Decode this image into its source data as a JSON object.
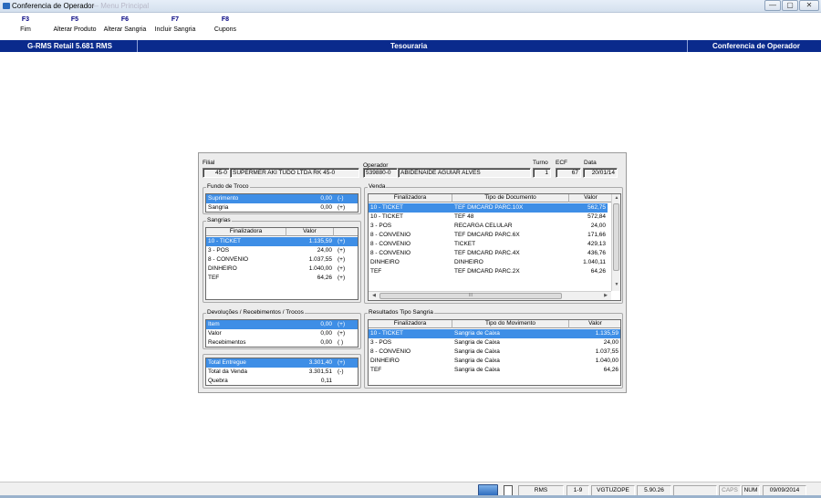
{
  "window": {
    "title": "Conferencia de Operador",
    "bg_title": "— Menu Principal"
  },
  "controls": {
    "minimize": "—",
    "maximize": "▢",
    "close": "✕"
  },
  "toolbar": [
    {
      "key": "F3",
      "label": "Fim"
    },
    {
      "key": "F5",
      "label": "Alterar Produto"
    },
    {
      "key": "F6",
      "label": "Alterar Sangria"
    },
    {
      "key": "F7",
      "label": "Incluir Sangria"
    },
    {
      "key": "F8",
      "label": "Cupons"
    }
  ],
  "bluebar": {
    "left": "G-RMS Retail 5.681 RMS",
    "center": "Tesouraria",
    "right": "Conferencia de Operador"
  },
  "header": {
    "filial_label": "Filial",
    "filial_code": "45-0",
    "filial_name": "SUPERMER AKI TUDO LTDA RK 45-0",
    "operador_label": "Operador",
    "operador_code": "539880-0",
    "operador_name": "ABIDENAIDE AGUIAR ALVES",
    "turno_label": "Turno",
    "turno": "1",
    "ecf_label": "ECF",
    "ecf": "67",
    "data_label": "Data",
    "data": "20/01/14"
  },
  "fundo": {
    "title": "Fundo de Troco",
    "rows": [
      {
        "name": "Suprimento",
        "value": "0,00",
        "flag": "(-)"
      },
      {
        "name": "Sangria",
        "value": "0,00",
        "flag": "(+)"
      }
    ]
  },
  "sangrias": {
    "title": "Sangrias",
    "headers": [
      "Finalizadora",
      "Valor"
    ],
    "rows": [
      {
        "name": "10 - TICKET",
        "value": "1.135,59",
        "flag": "(+)"
      },
      {
        "name": "3 - POS",
        "value": "24,00",
        "flag": "(+)"
      },
      {
        "name": "8 - CONVENIO",
        "value": "1.037,55",
        "flag": "(+)"
      },
      {
        "name": "DINHEIRO",
        "value": "1.040,00",
        "flag": "(+)"
      },
      {
        "name": "TEF",
        "value": "64,26",
        "flag": "(+)"
      }
    ]
  },
  "devolucoes": {
    "title": "Devoluções / Recebimentos / Trocos",
    "rows": [
      {
        "name": "Item",
        "value": "0,00",
        "flag": "(+)"
      },
      {
        "name": "Valor",
        "value": "0,00",
        "flag": "(+)"
      },
      {
        "name": "Recebimentos",
        "value": "0,00",
        "flag": "( )"
      }
    ]
  },
  "totais": {
    "rows": [
      {
        "name": "Total Entregue",
        "value": "3.301,40",
        "flag": "(+)"
      },
      {
        "name": "Total da Venda",
        "value": "3.301,51",
        "flag": "(-)"
      },
      {
        "name": "Quebra",
        "value": "0,11",
        "flag": ""
      }
    ]
  },
  "venda": {
    "title": "Venda",
    "headers": [
      "Finalizadora",
      "Tipo de Documento",
      "Valor"
    ],
    "rows": [
      {
        "fin": "10 - TICKET",
        "tipo": "TEF DMCARD PARC.10X",
        "valor": "562,75"
      },
      {
        "fin": "10 - TICKET",
        "tipo": "TEF 48",
        "valor": "572,84"
      },
      {
        "fin": "3 - POS",
        "tipo": "RECARGA CELULAR",
        "valor": "24,00"
      },
      {
        "fin": "8 - CONVENIO",
        "tipo": "TEF DMCARD PARC.6X",
        "valor": "171,66"
      },
      {
        "fin": "8 - CONVENIO",
        "tipo": "TICKET",
        "valor": "429,13"
      },
      {
        "fin": "8 - CONVENIO",
        "tipo": "TEF DMCARD PARC.4X",
        "valor": "436,76"
      },
      {
        "fin": "DINHEIRO",
        "tipo": "DINHEIRO",
        "valor": "1.040,11"
      },
      {
        "fin": "TEF",
        "tipo": "TEF DMCARD PARC.2X",
        "valor": "64,26"
      }
    ],
    "hscroll_mark": "III"
  },
  "resultados": {
    "title": "Resultados Tipo Sangria",
    "headers": [
      "Finalizadora",
      "Tipo do Movimento",
      "Valor"
    ],
    "rows": [
      {
        "fin": "10 - TICKET",
        "tipo": "Sangria de Caixa",
        "valor": "1.135,59"
      },
      {
        "fin": "3 - POS",
        "tipo": "Sangria de Caixa",
        "valor": "24,00"
      },
      {
        "fin": "8 - CONVENIO",
        "tipo": "Sangria de Caixa",
        "valor": "1.037,55"
      },
      {
        "fin": "DINHEIRO",
        "tipo": "Sangria de Caixa",
        "valor": "1.040,00"
      },
      {
        "fin": "TEF",
        "tipo": "Sangria de Caixa",
        "valor": "64,26"
      }
    ]
  },
  "status": {
    "app": "RMS",
    "page": "1-9",
    "user": "VGTUZOPE",
    "version": "5.90.26",
    "caps": "CAPS",
    "num": "NUM",
    "date": "09/09/2014"
  }
}
